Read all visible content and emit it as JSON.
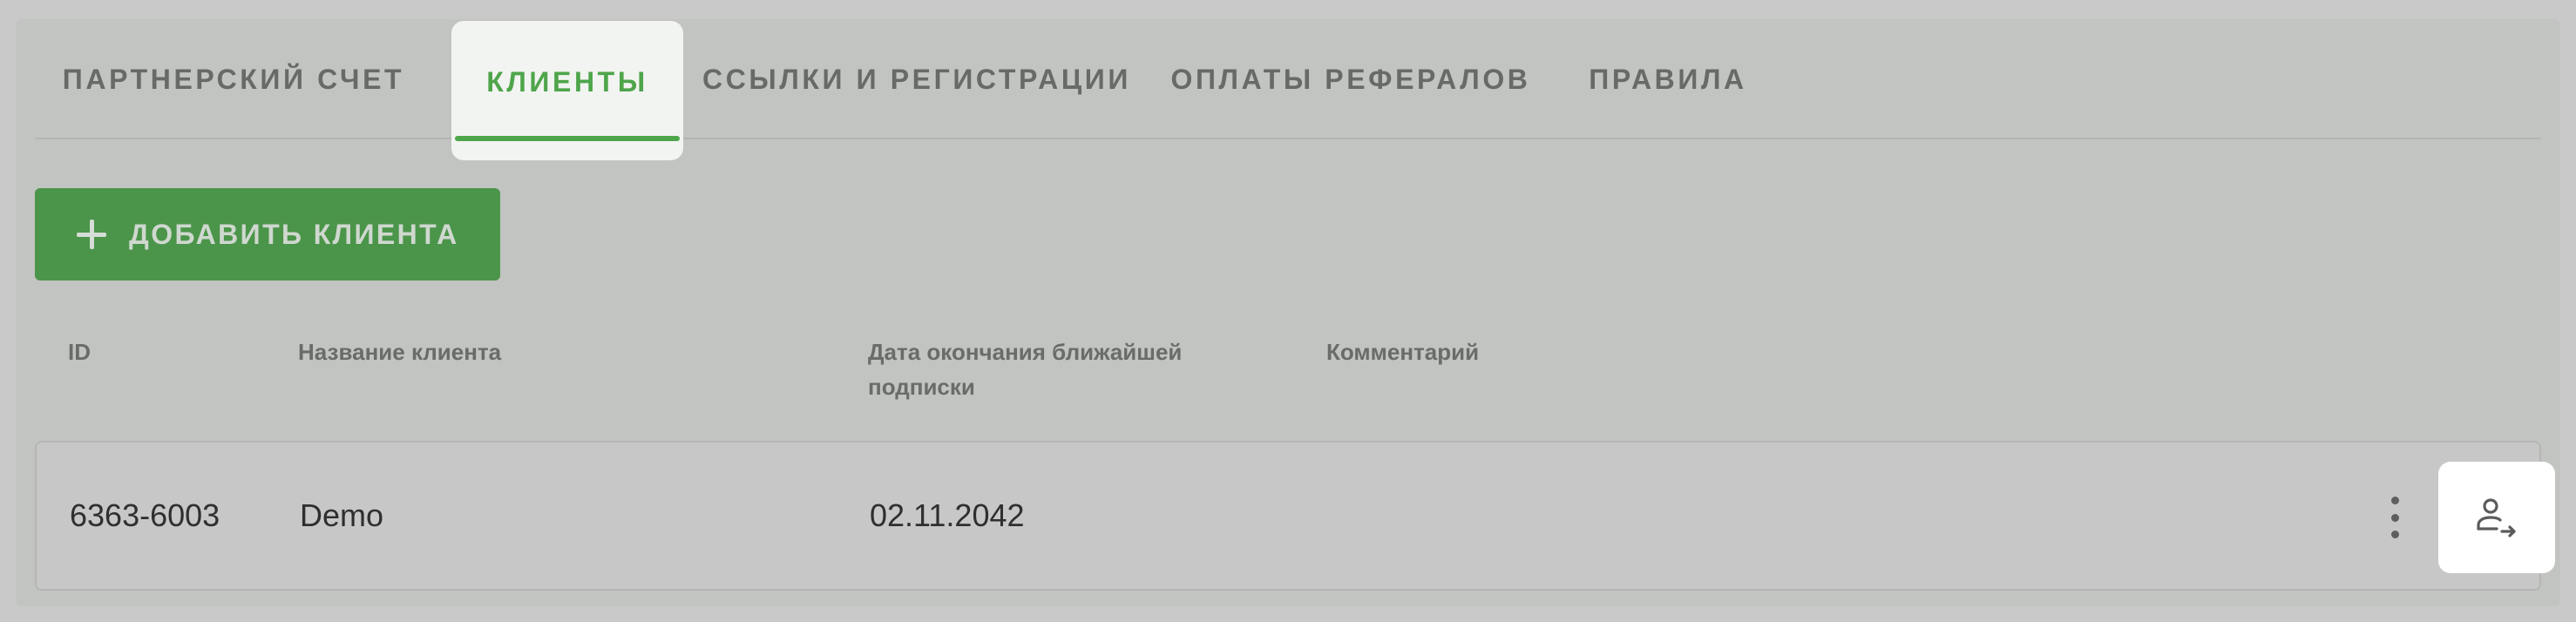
{
  "tabs": [
    {
      "label": "ПАРТНЕРСКИЙ СЧЕТ",
      "active": false
    },
    {
      "label": "КЛИЕНТЫ",
      "active": true
    },
    {
      "label": "ССЫЛКИ И РЕГИСТРАЦИИ",
      "active": false
    },
    {
      "label": "ОПЛАТЫ РЕФЕРАЛОВ",
      "active": false
    },
    {
      "label": "ПРАВИЛА",
      "active": false
    }
  ],
  "toolbar": {
    "add_icon": "plus-icon",
    "add_label": "ДОБАВИТЬ КЛИЕНТА"
  },
  "table": {
    "columns": [
      "ID",
      "Название клиента",
      "Дата окончания ближайшей подписки",
      "Комментарий"
    ],
    "rows": [
      {
        "id": "6363-6003",
        "name": "Demo",
        "date": "02.11.2042",
        "comment": "",
        "actions": {
          "menu_icon": "more-vertical-icon",
          "login_icon": "user-login-icon"
        }
      }
    ]
  },
  "colors": {
    "accent": "#4ea54a",
    "button": "#4b954a",
    "background": "#c2c4c1"
  }
}
